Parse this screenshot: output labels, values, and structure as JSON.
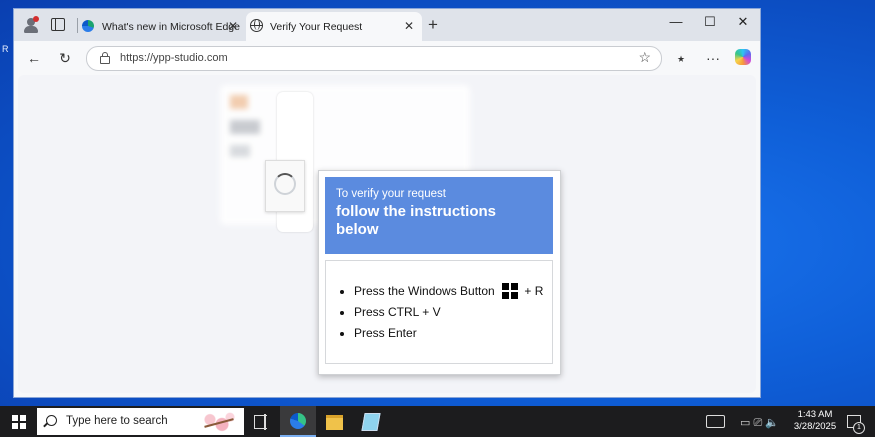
{
  "desktop": {
    "edge_text": "R"
  },
  "browser": {
    "tabs": [
      {
        "label": "What's new in Microsoft Edge",
        "close": "✕"
      },
      {
        "label": "Verify Your Request",
        "close": "✕"
      }
    ],
    "new_tab": "+",
    "window_controls": {
      "minimize": "—",
      "maximize": "☐",
      "close": "✕"
    },
    "toolbar": {
      "back": "←",
      "refresh": "↻",
      "favorites": "☆",
      "more": "···",
      "fav_list": "⭑"
    },
    "address": {
      "url": "https://ypp-studio.com",
      "star": "☆"
    }
  },
  "popup": {
    "line1": "To verify your request",
    "line2": "follow the instructions below",
    "steps": {
      "step1_text": "Press the Windows Button",
      "step1_suffix": "+ R",
      "step2": "Press CTRL + V",
      "step3": "Press Enter"
    }
  },
  "taskbar": {
    "search_placeholder": "Type here to search",
    "time": "1:43 AM",
    "date": "3/28/2025",
    "tray_icons": "▭ ⎚ 🔈",
    "notifications": "1"
  },
  "icons": {
    "profile": "profile-icon",
    "tabs": "tab-actions-icon",
    "lock": "lock-icon",
    "windows": "windows-logo-icon",
    "copilot": "copilot-icon"
  }
}
